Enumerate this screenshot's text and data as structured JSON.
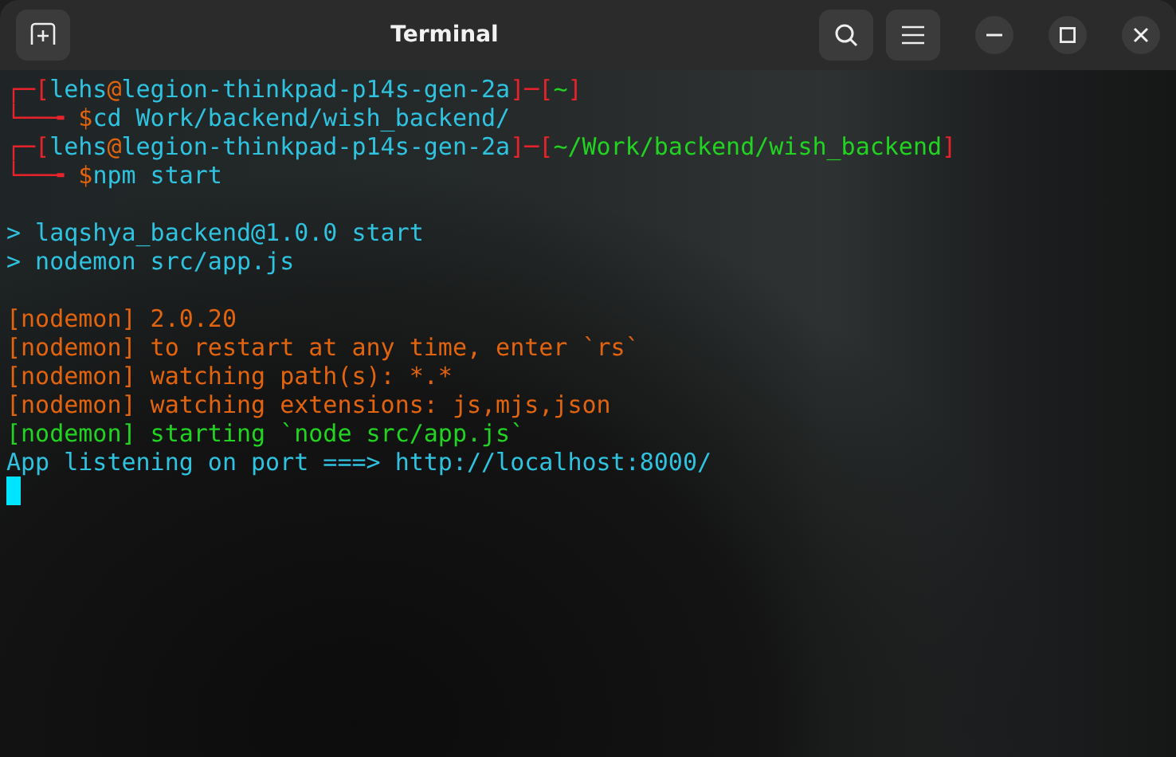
{
  "window": {
    "title": "Terminal"
  },
  "blocks": [
    [
      [
        {
          "text": "┌─[",
          "kind": "red"
        },
        {
          "text": "lehs",
          "kind": "cyan"
        },
        {
          "text": "@",
          "kind": "orange"
        },
        {
          "text": "legion-thinkpad-p14s-gen-2a",
          "kind": "cyan"
        },
        {
          "text": "]─[",
          "kind": "red"
        },
        {
          "text": "~",
          "kind": "green"
        },
        {
          "text": "]",
          "kind": "red"
        }
      ],
      [
        {
          "text": "└──╼ ",
          "kind": "red"
        },
        {
          "text": "$",
          "kind": "orange"
        },
        {
          "text": "cd Work/backend/wish_backend/",
          "kind": "cyan"
        }
      ],
      [
        {
          "text": "┌─[",
          "kind": "red"
        },
        {
          "text": "lehs",
          "kind": "cyan"
        },
        {
          "text": "@",
          "kind": "orange"
        },
        {
          "text": "legion-thinkpad-p14s-gen-2a",
          "kind": "cyan"
        },
        {
          "text": "]─[",
          "kind": "red"
        },
        {
          "text": "~/Work/backend/wish_backend",
          "kind": "green"
        },
        {
          "text": "]",
          "kind": "red"
        }
      ],
      [
        {
          "text": "└──╼ ",
          "kind": "red"
        },
        {
          "text": "$",
          "kind": "orange"
        },
        {
          "text": "npm start",
          "kind": "cyan"
        }
      ]
    ],
    [
      [
        {
          "text": "> laqshya_backend@1.0.0 start",
          "kind": "cyan"
        }
      ],
      [
        {
          "text": "> nodemon src/app.js",
          "kind": "cyan"
        }
      ]
    ],
    [
      [
        {
          "text": "[nodemon] 2.0.20",
          "kind": "orange"
        }
      ],
      [
        {
          "text": "[nodemon] to restart at any time, enter `rs`",
          "kind": "orange"
        }
      ],
      [
        {
          "text": "[nodemon] watching path(s): *.*",
          "kind": "orange"
        }
      ],
      [
        {
          "text": "[nodemon] watching extensions: js,mjs,json",
          "kind": "orange"
        }
      ],
      [
        {
          "text": "[nodemon] starting `node src/app.js`",
          "kind": "green"
        }
      ],
      [
        {
          "text": "App listening on port ===> http://localhost:8000/",
          "kind": "cyan"
        }
      ]
    ]
  ]
}
